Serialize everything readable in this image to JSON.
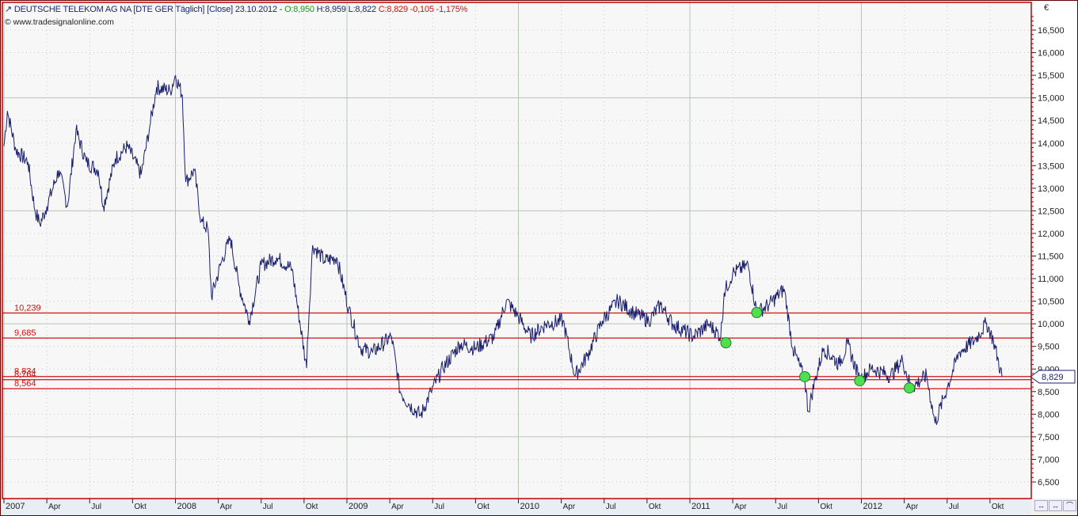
{
  "header": {
    "icon": "line-chart-icon",
    "name": "DEUTSCHE TELEKOM AG NA [DTE GER  Täglich] [Close] 23.10.2012 -",
    "open": "O:8,950",
    "high_low": "H:8,959 L:8,822",
    "close_change": "C:8,829 -0,105 -1,175%",
    "source": "www.tradesignalonline.com",
    "currency": "€"
  },
  "colors": {
    "line": "#1a1f6e",
    "level": "#d01010",
    "marker": "#4ee04e",
    "border": "#c00000"
  },
  "controls": [
    "↔",
    "↔",
    "⌒"
  ],
  "chart_data": {
    "type": "line",
    "title": "DEUTSCHE TELEKOM AG NA [DTE GER Täglich] [Close]",
    "ylabel": "€",
    "ylim": [
      6.2,
      16.9
    ],
    "xlim": [
      2007.0,
      2013.0
    ],
    "y_ticks": [
      "6,500",
      "7,000",
      "7,500",
      "8,000",
      "8,500",
      "9,000",
      "9,500",
      "10,000",
      "10,500",
      "11,000",
      "11,500",
      "12,000",
      "12,500",
      "13,000",
      "13,500",
      "14,000",
      "14,500",
      "15,000",
      "15,500",
      "16,000",
      "16,500"
    ],
    "y_tick_values": [
      6.5,
      7,
      7.5,
      8,
      8.5,
      9,
      9.5,
      10,
      10.5,
      11,
      11.5,
      12,
      12.5,
      13,
      13.5,
      14,
      14.5,
      15,
      15.5,
      16,
      16.5
    ],
    "x_ticks": [
      {
        "t": 2007.0,
        "l": "2007",
        "major": true
      },
      {
        "t": 2007.25,
        "l": "Apr"
      },
      {
        "t": 2007.5,
        "l": "Jul"
      },
      {
        "t": 2007.75,
        "l": "Okt"
      },
      {
        "t": 2008.0,
        "l": "2008",
        "major": true
      },
      {
        "t": 2008.25,
        "l": "Apr"
      },
      {
        "t": 2008.5,
        "l": "Jul"
      },
      {
        "t": 2008.75,
        "l": "Okt"
      },
      {
        "t": 2009.0,
        "l": "2009",
        "major": true
      },
      {
        "t": 2009.25,
        "l": "Apr"
      },
      {
        "t": 2009.5,
        "l": "Jul"
      },
      {
        "t": 2009.75,
        "l": "Okt"
      },
      {
        "t": 2010.0,
        "l": "2010",
        "major": true
      },
      {
        "t": 2010.25,
        "l": "Apr"
      },
      {
        "t": 2010.5,
        "l": "Jul"
      },
      {
        "t": 2010.75,
        "l": "Okt"
      },
      {
        "t": 2011.0,
        "l": "2011",
        "major": true
      },
      {
        "t": 2011.25,
        "l": "Apr"
      },
      {
        "t": 2011.5,
        "l": "Jul"
      },
      {
        "t": 2011.75,
        "l": "Okt"
      },
      {
        "t": 2012.0,
        "l": "2012",
        "major": true
      },
      {
        "t": 2012.25,
        "l": "Apr"
      },
      {
        "t": 2012.5,
        "l": "Jul"
      },
      {
        "t": 2012.75,
        "l": "Okt"
      }
    ],
    "series": [
      {
        "name": "Close",
        "points": [
          [
            2007.0,
            13.93
          ],
          [
            2007.02,
            14.71
          ],
          [
            2007.07,
            13.84
          ],
          [
            2007.14,
            13.58
          ],
          [
            2007.18,
            12.52
          ],
          [
            2007.21,
            12.2
          ],
          [
            2007.25,
            12.6
          ],
          [
            2007.32,
            13.4
          ],
          [
            2007.37,
            12.6
          ],
          [
            2007.42,
            14.28
          ],
          [
            2007.48,
            13.58
          ],
          [
            2007.55,
            13.4
          ],
          [
            2007.58,
            12.6
          ],
          [
            2007.65,
            13.66
          ],
          [
            2007.72,
            13.93
          ],
          [
            2007.8,
            13.3
          ],
          [
            2007.85,
            14.36
          ],
          [
            2007.89,
            15.24
          ],
          [
            2007.97,
            15.15
          ],
          [
            2008.0,
            15.5
          ],
          [
            2008.04,
            15.06
          ],
          [
            2008.06,
            13.14
          ],
          [
            2008.11,
            13.4
          ],
          [
            2008.15,
            12.26
          ],
          [
            2008.19,
            12.09
          ],
          [
            2008.21,
            10.6
          ],
          [
            2008.27,
            11.39
          ],
          [
            2008.32,
            11.9
          ],
          [
            2008.37,
            10.85
          ],
          [
            2008.43,
            10.07
          ],
          [
            2008.5,
            11.3
          ],
          [
            2008.59,
            11.47
          ],
          [
            2008.68,
            11.21
          ],
          [
            2008.765,
            9.02
          ],
          [
            2008.77,
            9.63
          ],
          [
            2008.8,
            11.74
          ],
          [
            2008.87,
            11.39
          ],
          [
            2008.94,
            11.47
          ],
          [
            2009.01,
            10.34
          ],
          [
            2009.08,
            9.46
          ],
          [
            2009.15,
            9.37
          ],
          [
            2009.26,
            9.72
          ],
          [
            2009.31,
            8.5
          ],
          [
            2009.36,
            8.23
          ],
          [
            2009.43,
            7.97
          ],
          [
            2009.49,
            8.5
          ],
          [
            2009.56,
            9.02
          ],
          [
            2009.66,
            9.55
          ],
          [
            2009.75,
            9.46
          ],
          [
            2009.86,
            9.72
          ],
          [
            2009.93,
            10.51
          ],
          [
            2010.0,
            10.16
          ],
          [
            2010.07,
            9.72
          ],
          [
            2010.16,
            9.99
          ],
          [
            2010.26,
            10.07
          ],
          [
            2010.33,
            8.85
          ],
          [
            2010.4,
            9.28
          ],
          [
            2010.49,
            10.07
          ],
          [
            2010.58,
            10.51
          ],
          [
            2010.67,
            10.25
          ],
          [
            2010.76,
            10.07
          ],
          [
            2010.83,
            10.42
          ],
          [
            2010.9,
            9.99
          ],
          [
            2011.02,
            9.72
          ],
          [
            2011.11,
            9.99
          ],
          [
            2011.18,
            9.72
          ],
          [
            2011.2,
            10.69
          ],
          [
            2011.25,
            11.12
          ],
          [
            2011.34,
            11.3
          ],
          [
            2011.39,
            10.25
          ],
          [
            2011.46,
            10.42
          ],
          [
            2011.55,
            10.77
          ],
          [
            2011.6,
            9.46
          ],
          [
            2011.67,
            8.76
          ],
          [
            2011.69,
            8.06
          ],
          [
            2011.73,
            8.76
          ],
          [
            2011.78,
            9.46
          ],
          [
            2011.87,
            9.11
          ],
          [
            2011.92,
            9.55
          ],
          [
            2011.99,
            8.76
          ],
          [
            2012.06,
            9.02
          ],
          [
            2012.17,
            8.85
          ],
          [
            2012.24,
            9.2
          ],
          [
            2012.29,
            8.58
          ],
          [
            2012.38,
            8.85
          ],
          [
            2012.43,
            7.8
          ],
          [
            2012.5,
            8.58
          ],
          [
            2012.57,
            9.37
          ],
          [
            2012.66,
            9.63
          ],
          [
            2012.73,
            10.02
          ],
          [
            2012.77,
            9.63
          ],
          [
            2012.82,
            8.83
          ]
        ]
      }
    ],
    "levels": [
      {
        "value": 10.239,
        "label": "10,239"
      },
      {
        "value": 9.685,
        "label": "9,685"
      },
      {
        "value": 8.834,
        "label": "8,834"
      },
      {
        "value": 8.764,
        "label": "8,764"
      },
      {
        "value": 8.564,
        "label": "8,564"
      }
    ],
    "signals": [
      [
        2011.21,
        9.58
      ],
      [
        2011.39,
        10.25
      ],
      [
        2011.67,
        8.83
      ],
      [
        2011.99,
        8.74
      ],
      [
        2012.28,
        8.58
      ]
    ],
    "last_price": {
      "value": 8.829,
      "label": "8,829"
    }
  }
}
